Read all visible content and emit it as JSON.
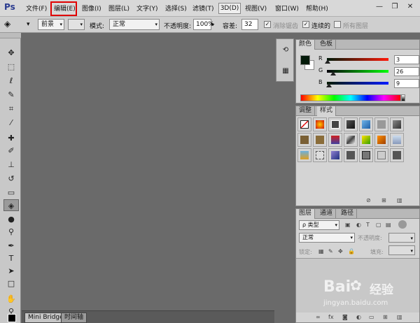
{
  "app": {
    "logo": "Ps"
  },
  "menu": {
    "items": [
      "文件(F)",
      "编辑(E)",
      "图像(I)",
      "图层(L)",
      "文字(Y)",
      "选择(S)",
      "滤镜(T)",
      "3D(D)",
      "视图(V)",
      "窗口(W)",
      "帮助(H)"
    ]
  },
  "window_controls": {
    "minimize": "—",
    "restore": "❐",
    "close": "✕"
  },
  "options": {
    "fill_source": "前景",
    "mode_label": "模式:",
    "mode_value": "正常",
    "opacity_label": "不透明度:",
    "opacity_value": "100%",
    "tolerance_label": "容差:",
    "tolerance_value": "32",
    "antialias_label": "消除锯齿",
    "contiguous_label": "连续的",
    "all_layers_label": "所有图层"
  },
  "bottom_tabs": [
    "Mini Bridge",
    "时间轴"
  ],
  "color_panel": {
    "tabs": [
      "颜色",
      "色板"
    ],
    "r_label": "R",
    "r_value": "3",
    "g_label": "G",
    "g_value": "26",
    "b_label": "B",
    "b_value": "9",
    "r": 3,
    "g": 26,
    "b": 9
  },
  "adjust_panel": {
    "tabs": [
      "调整",
      "样式"
    ]
  },
  "layers_panel": {
    "tabs": [
      "图层",
      "通道",
      "路径"
    ],
    "kind_label": "ρ 类型",
    "blend_mode": "正常",
    "opacity_label": "不透明度:",
    "lock_label": "锁定:",
    "fill_label": "填充:"
  },
  "watermark": {
    "brand": "Bai",
    "brand2": "经验",
    "url": "jingyan.baidu.com"
  },
  "colors": {
    "highlight": "#e00000",
    "fg_swatch": "#031a09"
  }
}
